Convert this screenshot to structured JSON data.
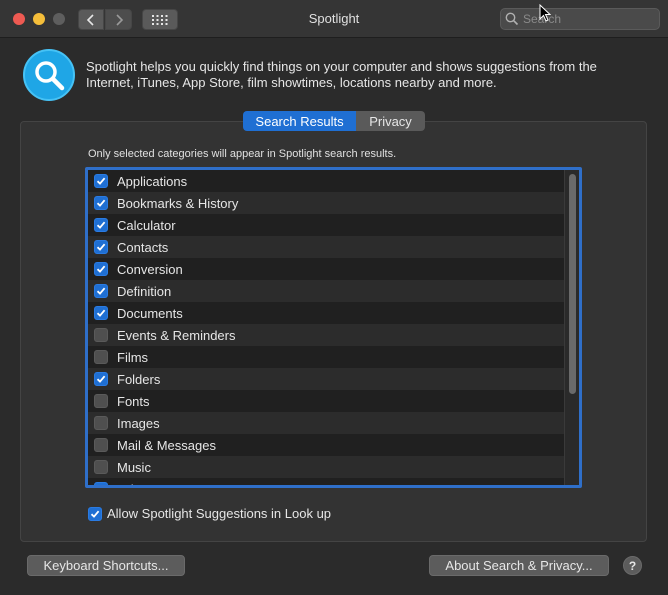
{
  "window": {
    "title": "Spotlight"
  },
  "toolbar": {
    "search_placeholder": "Search",
    "icons": {
      "back": "chevron-left-icon",
      "forward": "chevron-right-icon",
      "grid": "grid-icon",
      "search": "search-icon"
    }
  },
  "header": {
    "description": "Spotlight helps you quickly find things on your computer and shows suggestions from the Internet, iTunes, App Store, film showtimes, locations nearby and more."
  },
  "tabs": [
    {
      "label": "Search Results",
      "active": true
    },
    {
      "label": "Privacy",
      "active": false
    }
  ],
  "search_results": {
    "hint": "Only selected categories will appear in Spotlight search results.",
    "categories": [
      {
        "label": "Applications",
        "checked": true
      },
      {
        "label": "Bookmarks & History",
        "checked": true
      },
      {
        "label": "Calculator",
        "checked": true
      },
      {
        "label": "Contacts",
        "checked": true
      },
      {
        "label": "Conversion",
        "checked": true
      },
      {
        "label": "Definition",
        "checked": true
      },
      {
        "label": "Documents",
        "checked": true
      },
      {
        "label": "Events & Reminders",
        "checked": false
      },
      {
        "label": "Films",
        "checked": false
      },
      {
        "label": "Folders",
        "checked": true
      },
      {
        "label": "Fonts",
        "checked": false
      },
      {
        "label": "Images",
        "checked": false
      },
      {
        "label": "Mail & Messages",
        "checked": false
      },
      {
        "label": "Music",
        "checked": false
      },
      {
        "label": "Other",
        "checked": true
      }
    ],
    "allow_suggestions": {
      "label": "Allow Spotlight Suggestions in Look up",
      "checked": true
    }
  },
  "footer": {
    "keyboard_shortcuts_label": "Keyboard Shortcuts...",
    "about_label": "About Search & Privacy...",
    "help_label": "?"
  },
  "colors": {
    "accent": "#1f6fd3",
    "focus_ring": "#2f6fc9",
    "icon_bg": "#1fa6e6"
  }
}
